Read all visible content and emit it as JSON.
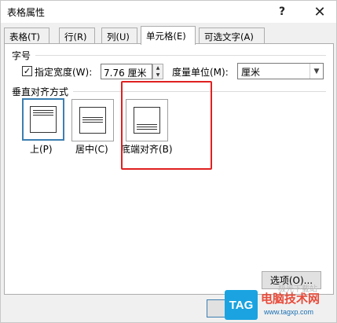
{
  "window": {
    "title": "表格属性",
    "help_label": "?",
    "close_label": "✕"
  },
  "tabs": [
    {
      "label": "表格(T)"
    },
    {
      "label": "行(R)"
    },
    {
      "label": "列(U)"
    },
    {
      "label": "单元格(E)"
    },
    {
      "label": "可选文字(A)"
    }
  ],
  "size_section": {
    "title": "字号",
    "specify_width_checked": true,
    "specify_width_label": "指定宽度(W):",
    "width_value": "7.76 厘米",
    "unit_label": "度量单位(M):",
    "unit_value": "厘米"
  },
  "valign_section": {
    "title": "垂直对齐方式",
    "options": [
      {
        "label": "上(P)",
        "selected": true
      },
      {
        "label": "居中(C)",
        "selected": false
      },
      {
        "label": "底端对齐(B)",
        "selected": false
      }
    ]
  },
  "buttons": {
    "options_label": "选项(O)..."
  },
  "annotation": {
    "highlight_color": "#e02020"
  },
  "watermark": {
    "tag": "TAG",
    "name": "电脑技术网",
    "url": "www.tagxp.com",
    "top_text": "极光下载站"
  }
}
